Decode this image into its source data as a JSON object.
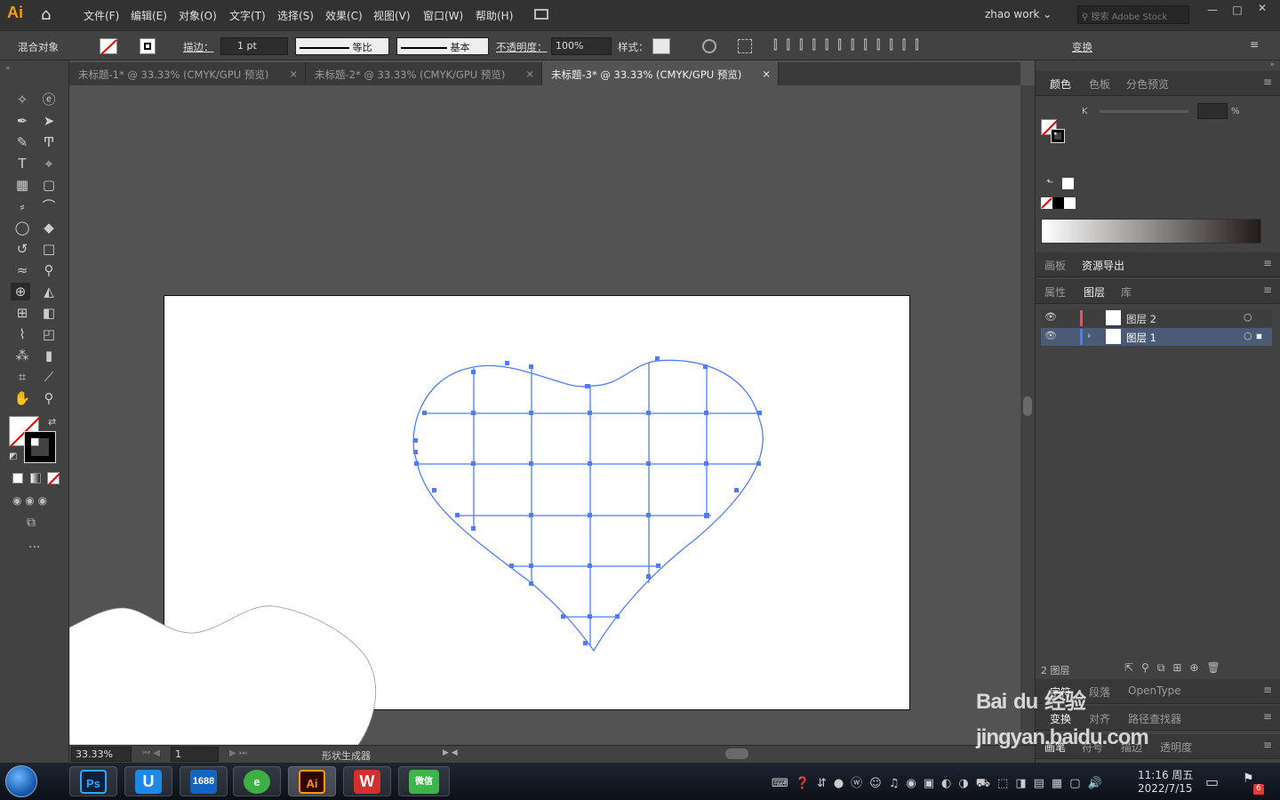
{
  "app": {
    "logo": "Ai",
    "workspace": "zhao work",
    "search_placeholder": "搜索 Adobe Stock"
  },
  "menu": [
    "文件(F)",
    "编辑(E)",
    "对象(O)",
    "文字(T)",
    "选择(S)",
    "效果(C)",
    "视图(V)",
    "窗口(W)",
    "帮助(H)"
  ],
  "control": {
    "selection_label": "混合对象",
    "stroke_label": "描边：",
    "stroke_value": "1 pt",
    "profile_label": "等比",
    "brush_label": "基本",
    "opacity_label": "不透明度：",
    "opacity_value": "100%",
    "style_label": "样式：",
    "transform_label": "变换"
  },
  "tabs": [
    {
      "label": "未标题-1* @ 33.33% (CMYK/GPU 预览)",
      "active": false
    },
    {
      "label": "未标题-2* @ 33.33% (CMYK/GPU 预览)",
      "active": false
    },
    {
      "label": "未标题-3* @ 33.33% (CMYK/GPU 预览)",
      "active": true
    }
  ],
  "status": {
    "zoom": "33.33%",
    "page": "1",
    "tool_name": "形状生成器"
  },
  "panels": {
    "color_tabs": [
      "颜色",
      "色板",
      "分色预览"
    ],
    "k_label": "K",
    "percent": "%",
    "export_tabs": [
      "画板",
      "资源导出"
    ],
    "layer_tabs": [
      "属性",
      "图层",
      "库"
    ],
    "layers": [
      {
        "name": "图层 2",
        "color": "#ff4d4d"
      },
      {
        "name": "图层 1",
        "color": "#4f7cff"
      }
    ],
    "layer_count": "2 图层",
    "char_tabs": [
      "字符",
      "段落",
      "OpenType"
    ],
    "transform_tabs": [
      "变换",
      "对齐",
      "路径查找器"
    ],
    "brush_tabs": [
      "画笔",
      "符号",
      "描边",
      "透明度"
    ]
  },
  "taskbar": {
    "apps": [
      "Ps",
      "U",
      "1688",
      "e",
      "Ai",
      "W",
      "微信"
    ],
    "time": "11:16 周五",
    "date": "2022/7/15",
    "badge": "6"
  },
  "watermark": "Bai du 经验 jingyan.baidu.com",
  "colors": {
    "accent": "#ff9a00",
    "path": "#4f7cff",
    "panel": "#424242",
    "canvas": "#535353"
  }
}
